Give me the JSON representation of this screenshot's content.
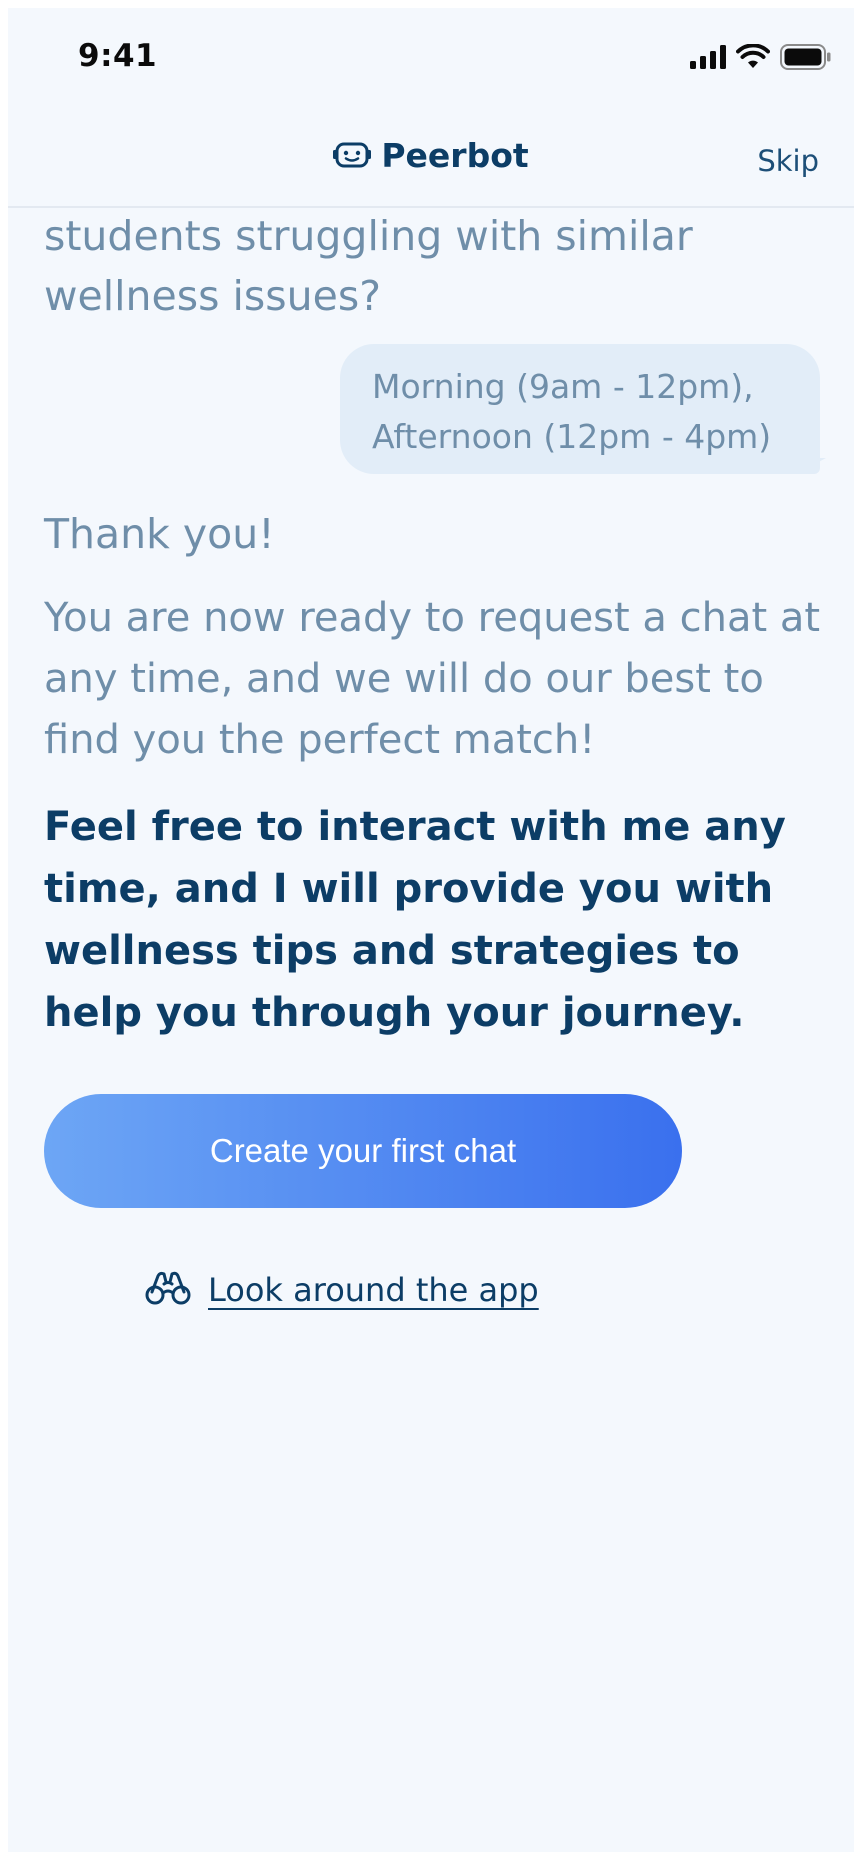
{
  "status_bar": {
    "time": "9:41",
    "icons": [
      "cellular-signal-icon",
      "wifi-icon",
      "battery-icon"
    ]
  },
  "nav": {
    "title": "Peerbot",
    "logo_icon": "bot-face-icon",
    "skip_label": "Skip"
  },
  "chat": {
    "bot_question_clipped": "students struggling with similar wellness issues?",
    "user_reply": "Morning (9am - 12pm), Afternoon (12pm - 4pm)",
    "thank_you": "Thank you!",
    "ready_message": "You are now ready to request a chat at any time, and we will do our best to find you the perfect match!",
    "feel_free_message": "Feel free to interact with me any time, and I will provide you with wellness tips and strategies to help you through your journey."
  },
  "actions": {
    "create_chat_label": "Create your first chat",
    "look_around_label": "Look around the app",
    "look_around_icon": "binoculars-icon"
  },
  "colors": {
    "background": "#f4f8fd",
    "primary_text": "#0c3d66",
    "muted_text": "#6f8ea9",
    "bubble": "#e2edf8",
    "button_gradient_start": "#6da6f5",
    "button_gradient_end": "#3a70ee"
  }
}
